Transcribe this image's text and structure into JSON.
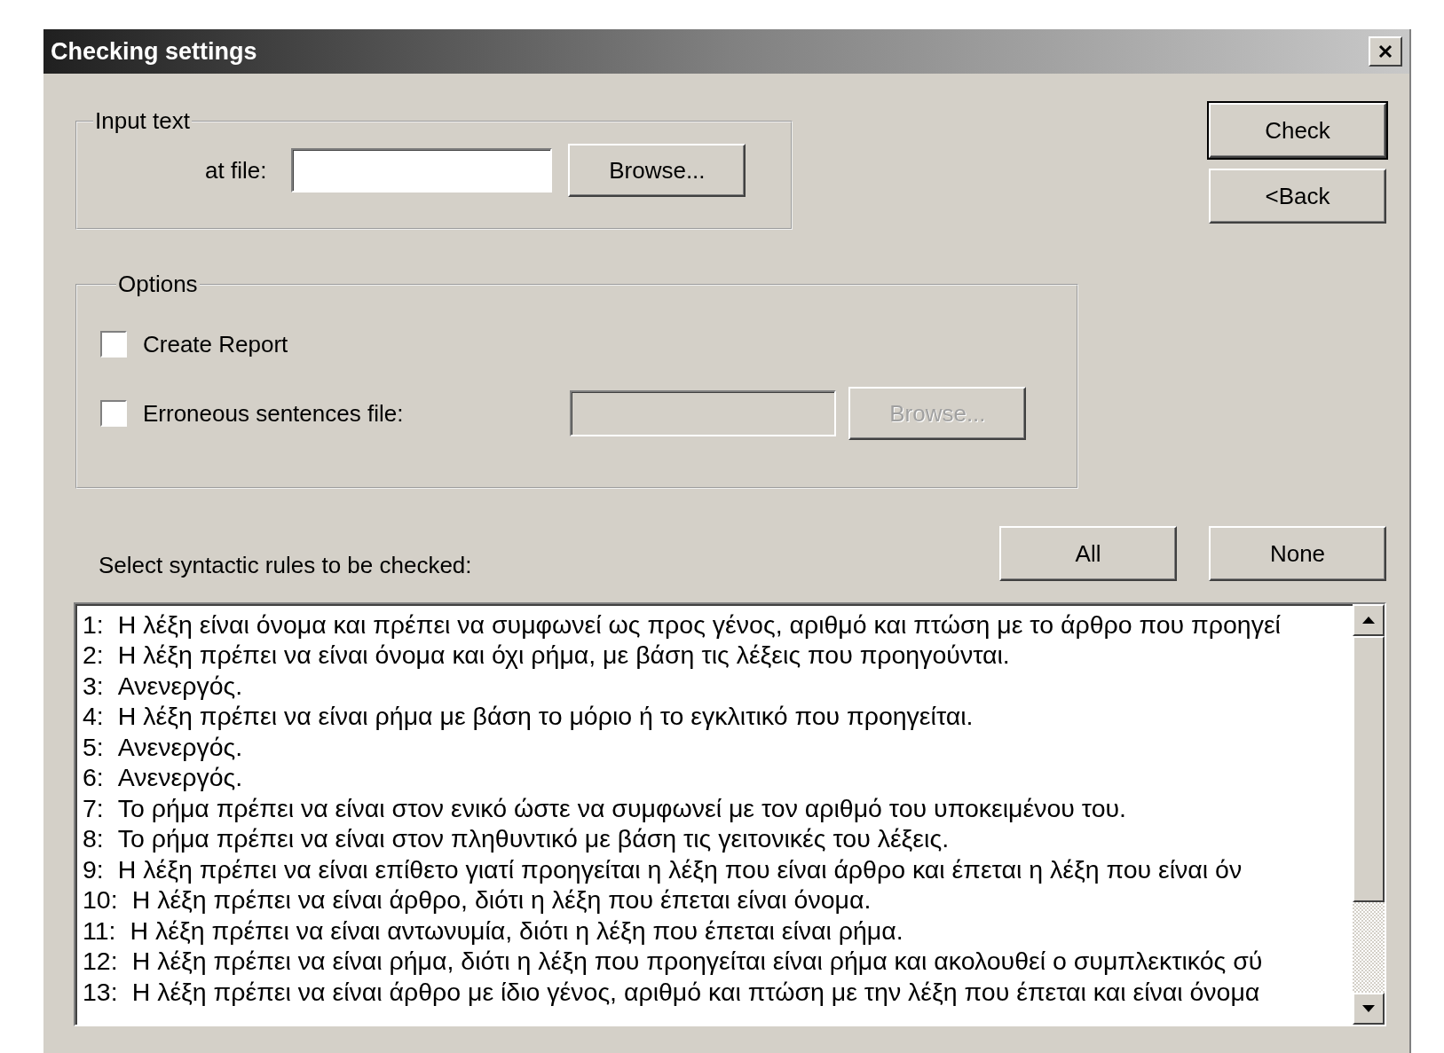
{
  "window": {
    "title": "Checking settings"
  },
  "input_text": {
    "legend": "Input text",
    "label": "at file:",
    "browse": {
      "label": "Browse...",
      "disabled": false
    }
  },
  "options": {
    "legend": "Options",
    "items": [
      {
        "kind": "checkbox",
        "label": "Create Report",
        "checked": false
      },
      {
        "kind": "checkbox_file",
        "label": "Erroneous sentences file:",
        "checked": false,
        "browse": {
          "label": "Browse...",
          "disabled": true
        }
      }
    ]
  },
  "buttons": [
    {
      "label": "Check",
      "default": true
    },
    {
      "label": "<Back",
      "default": false
    }
  ],
  "rules": {
    "label": "Select syntactic rules to be checked:",
    "buttons": [
      {
        "label": "All"
      },
      {
        "label": "None"
      }
    ],
    "items": [
      {
        "number": "1:",
        "text": "Η λέξη είναι όνομα και πρέπει να συμφωνεί ως προς γένος, αριθμό και πτώση με το άρθρο που προηγεί"
      },
      {
        "number": "2:",
        "text": "Η λέξη πρέπει να είναι όνομα και όχι ρήμα, με βάση τις λέξεις που προηγούνται."
      },
      {
        "number": "3:",
        "text": "Ανενεργός."
      },
      {
        "number": "4:",
        "text": "Η λέξη πρέπει να είναι ρήμα με βάση το μόριο ή το εγκλιτικό που προηγείται."
      },
      {
        "number": "5:",
        "text": "Ανενεργός."
      },
      {
        "number": "6:",
        "text": "Ανενεργός."
      },
      {
        "number": "7:",
        "text": "Το ρήμα πρέπει να είναι στον ενικό ώστε να συμφωνεί με τον αριθμό του υποκειμένου του."
      },
      {
        "number": "8:",
        "text": "Το ρήμα πρέπει να είναι στον πληθυντικό με βάση τις γειτονικές του λέξεις."
      },
      {
        "number": "9:",
        "text": "Η λέξη πρέπει να είναι επίθετο γιατί προηγείται η λέξη που είναι άρθρο και έπεται η λέξη που είναι όν"
      },
      {
        "number": "10:",
        "text": "Η λέξη πρέπει να είναι άρθρο, διότι η λέξη που έπεται είναι όνομα."
      },
      {
        "number": "11:",
        "text": "Η λέξη πρέπει να είναι αντωνυμία, διότι η λέξη που έπεται είναι ρήμα."
      },
      {
        "number": "12:",
        "text": "Η λέξη πρέπει να είναι ρήμα, διότι η λέξη που προηγείται είναι ρήμα και ακολουθεί ο συμπλεκτικός σύ"
      },
      {
        "number": "13:",
        "text": "Η λέξη πρέπει να είναι άρθρο με ίδιο γένος, αριθμό και πτώση με την λέξη που έπεται και είναι όνομα"
      }
    ]
  }
}
